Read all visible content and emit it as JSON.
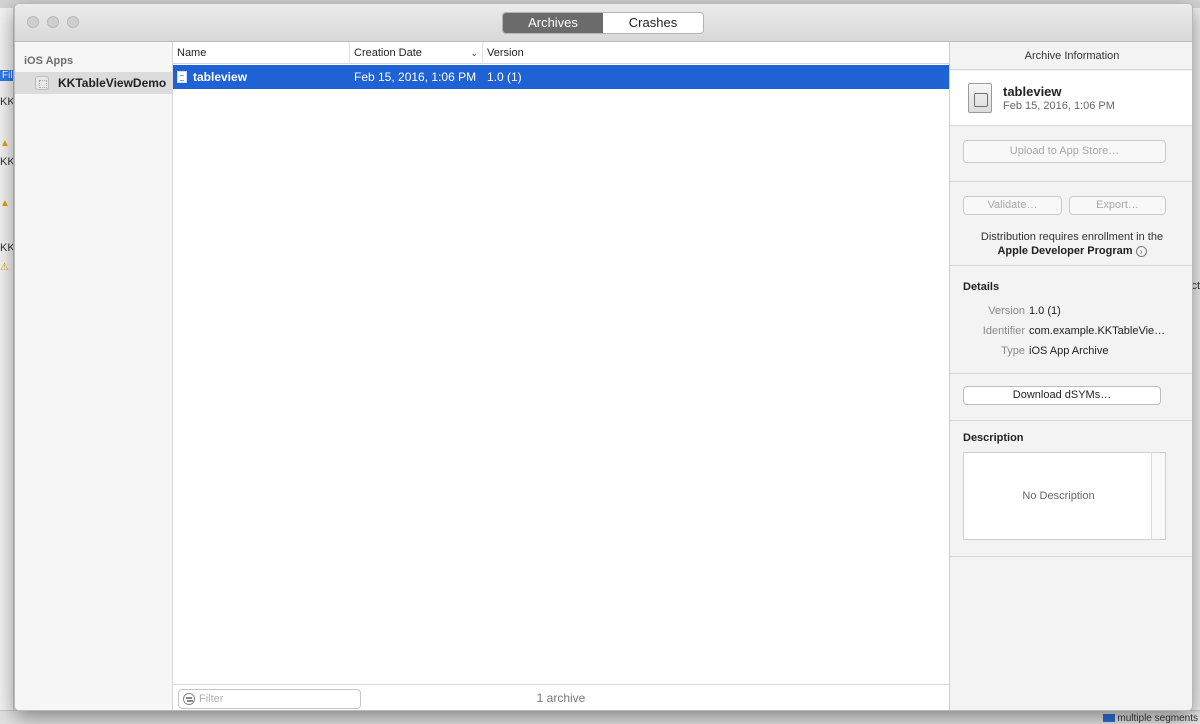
{
  "background": {
    "left_fragments": [
      "Fil",
      "KK",
      "KK",
      "KK"
    ],
    "right_fragment": "ct",
    "bottom_text": "multiple segments"
  },
  "window": {
    "tabs": [
      {
        "label": "Archives",
        "active": true
      },
      {
        "label": "Crashes",
        "active": false
      }
    ]
  },
  "sidebar": {
    "header": "iOS Apps",
    "items": [
      {
        "label": "KKTableViewDemo",
        "selected": true
      }
    ]
  },
  "archive_list": {
    "columns": {
      "name": "Name",
      "creation_date": "Creation Date",
      "version": "Version"
    },
    "sort_indicator": "chevron-down",
    "rows": [
      {
        "name": "tableview",
        "creation_date": "Feb 15, 2016, 1:06 PM",
        "version": "1.0 (1)",
        "selected": true
      }
    ],
    "filter_placeholder": "Filter",
    "count_label": "1 archive"
  },
  "inspector": {
    "title": "Archive Information",
    "archive_name": "tableview",
    "archive_date": "Feb 15, 2016, 1:06 PM",
    "upload_button": "Upload to App Store…",
    "validate_button": "Validate…",
    "export_button": "Export…",
    "distribution_note": "Distribution requires enrollment in the",
    "distribution_link": "Apple Developer Program",
    "details_title": "Details",
    "details": {
      "version_label": "Version",
      "version_value": "1.0 (1)",
      "identifier_label": "Identifier",
      "identifier_value": "com.example.KKTableVie…",
      "type_label": "Type",
      "type_value": "iOS App Archive"
    },
    "download_dsyms_button": "Download dSYMs…",
    "description_title": "Description",
    "description_placeholder": "No Description"
  },
  "colors": {
    "selection": "#1f62d5",
    "active_segment": "#6b6b6b"
  }
}
